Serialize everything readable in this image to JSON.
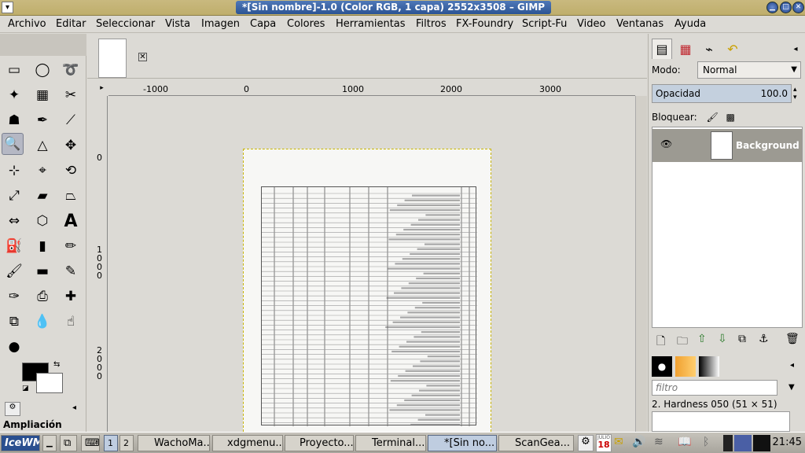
{
  "window": {
    "title": "*[Sin nombre]-1.0 (Color RGB, 1 capa) 2552x3508 – GIMP"
  },
  "menu": {
    "items": [
      "Archivo",
      "Editar",
      "Seleccionar",
      "Vista",
      "Imagen",
      "Capa",
      "Colores",
      "Herramientas",
      "Filtros",
      "FX-Foundry",
      "Script-Fu",
      "Video",
      "Ventanas",
      "Ayuda"
    ]
  },
  "toolbox": {
    "options_label": "Ampliación"
  },
  "rulers": {
    "h": [
      "-1000",
      "0",
      "1000",
      "2000",
      "3000"
    ],
    "v": [
      "0",
      "1000",
      "2000"
    ]
  },
  "layers_panel": {
    "mode_label": "Modo:",
    "mode_value": "Normal",
    "opacity_label": "Opacidad",
    "opacity_value": "100.0",
    "lock_label": "Bloquear:",
    "layer_name": "Background"
  },
  "brushes_panel": {
    "filter_placeholder": "filtro",
    "brush_name": "2. Hardness 050 (51 × 51)"
  },
  "taskbar": {
    "start": "IceWM",
    "workspaces": [
      "1",
      "2"
    ],
    "tasks": [
      "WachoMa...",
      "xdgmenu...",
      "Proyecto...",
      "Terminal...",
      "*[Sin no...",
      "ScanGea..."
    ],
    "calendar_day": "18",
    "calendar_month": "JULIO",
    "clock": "21:45"
  },
  "colors": {
    "accent": "#2c5494",
    "title_bar": "#c9b97f"
  }
}
